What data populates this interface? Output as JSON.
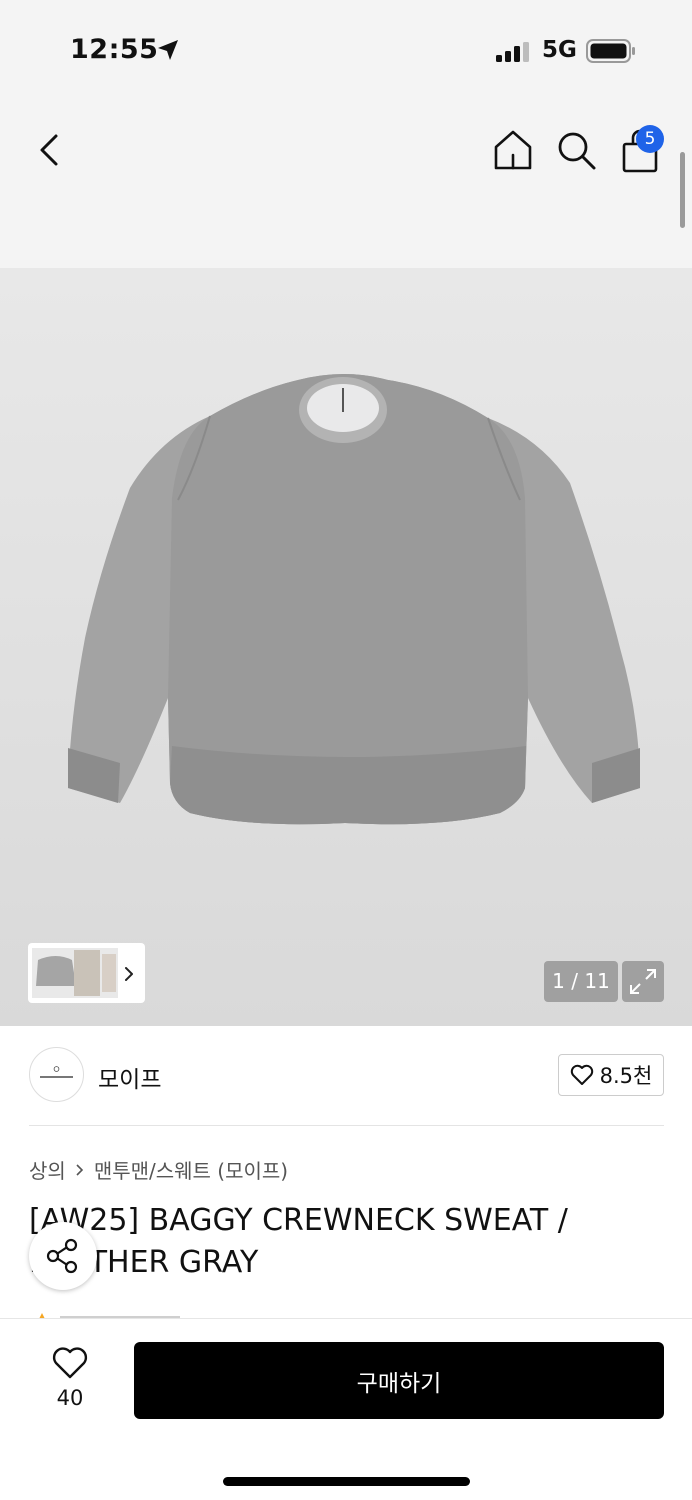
{
  "status_bar": {
    "time": "12:55",
    "network": "5G"
  },
  "header": {
    "cart_count": "5"
  },
  "gallery": {
    "page_counter": "1 / 11"
  },
  "brand": {
    "name": "모이프",
    "likes": "8.5천"
  },
  "breadcrumb": {
    "level1": "상의",
    "level2": "맨투맨/스웨트 (모이프)"
  },
  "product": {
    "title": "[AW25] BAGGY CREWNECK SWEAT / HEATHER GRAY"
  },
  "bottom": {
    "wish_count": "40",
    "buy_label": "구매하기"
  },
  "colors": {
    "badge_blue": "#1f63e8",
    "buy_button": "#000000"
  },
  "icons": [
    "location-arrow-icon",
    "signal-icon",
    "battery-icon",
    "chevron-left-icon",
    "home-icon",
    "search-icon",
    "shopping-bag-icon",
    "chevron-right-icon",
    "expand-icon",
    "heart-icon",
    "share-icon"
  ]
}
